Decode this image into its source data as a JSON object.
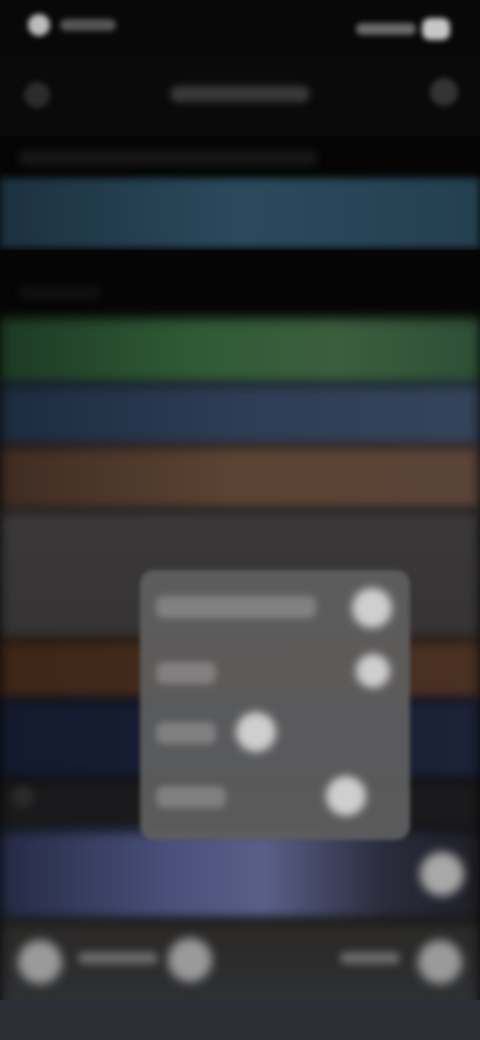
{
  "screen": {
    "status_bar": {
      "icons": [
        "status-icon",
        "signal-icon",
        "battery-icon"
      ]
    },
    "header": {
      "leading_icon": "back-icon",
      "trailing_icon": "more-icon"
    },
    "popup_menu": {
      "items": [
        {
          "icon": "toggle-icon"
        },
        {
          "icon": "toggle-icon"
        },
        {
          "icon": "toggle-icon"
        },
        {
          "icon": "toggle-icon"
        }
      ]
    },
    "bottom_bar": {
      "icons": [
        "left-action-icon",
        "center-action-icon",
        "right-action-icon"
      ]
    },
    "colors": {
      "background": "#050505",
      "row_highlight": "#2a4a5c",
      "popup": "#606060"
    }
  }
}
